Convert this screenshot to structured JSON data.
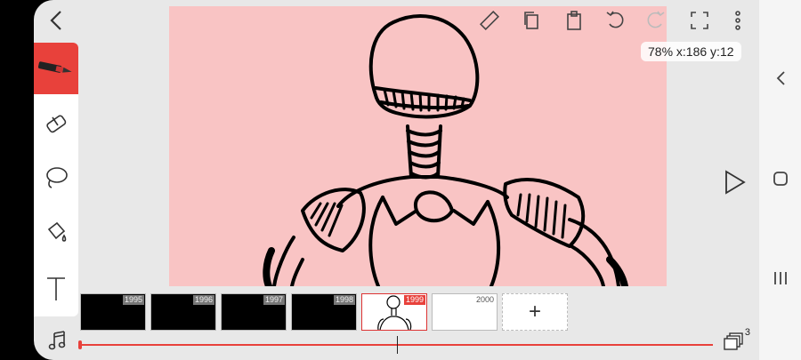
{
  "toolbar": {
    "back_icon": "chevron-left-icon",
    "icons": [
      "ruler-icon",
      "copy-icon",
      "clipboard-icon",
      "undo-icon",
      "redo-icon",
      "fullscreen-icon",
      "more-vert-icon"
    ]
  },
  "canvas": {
    "zoom_readout": "78% x:186 y:12",
    "background_color": "#f9c4c4"
  },
  "tools": [
    "pen-tool-icon",
    "eraser-icon",
    "lasso-icon",
    "paint-bucket-icon",
    "text-tool-icon"
  ],
  "timeline": {
    "frames": [
      {
        "number": "1995"
      },
      {
        "number": "1996"
      },
      {
        "number": "1997"
      },
      {
        "number": "1998"
      },
      {
        "number": "1999"
      },
      {
        "number": "2000"
      }
    ],
    "add_label": "+",
    "layers_count": "3",
    "playhead_fraction": 0.5
  },
  "accent_color": "#e8413b",
  "system_nav": [
    "chevron-left-icon",
    "play-icon",
    "home-icon",
    "recent-apps-icon"
  ]
}
